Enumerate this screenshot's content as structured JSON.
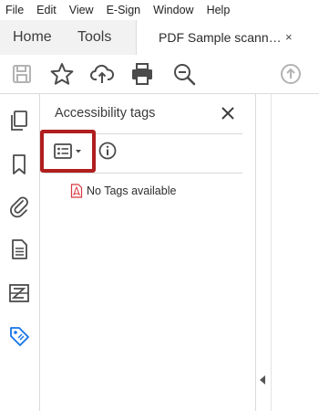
{
  "menubar": {
    "items": [
      "File",
      "Edit",
      "View",
      "E-Sign",
      "Window",
      "Help"
    ]
  },
  "tabs": {
    "home": "Home",
    "tools": "Tools",
    "document": {
      "title": "PDF Sample scann…",
      "close": "×"
    }
  },
  "toolbar": {
    "icons": [
      "save-icon",
      "star-icon",
      "cloud-upload-icon",
      "print-icon",
      "zoom-out-icon",
      "scroll-up-icon"
    ]
  },
  "leftrail": {
    "icons": [
      "page-thumbnails-icon",
      "bookmark-icon",
      "attachment-icon",
      "document-icon",
      "content-order-icon",
      "tag-icon"
    ]
  },
  "panel": {
    "title": "Accessibility tags",
    "options_icon": "list-options-icon",
    "info_icon": "info-icon",
    "empty_message": "No Tags available"
  },
  "colors": {
    "highlight_border": "#b01e1e",
    "active_icon": "#1473e6",
    "pdf_red": "#d7373f"
  }
}
